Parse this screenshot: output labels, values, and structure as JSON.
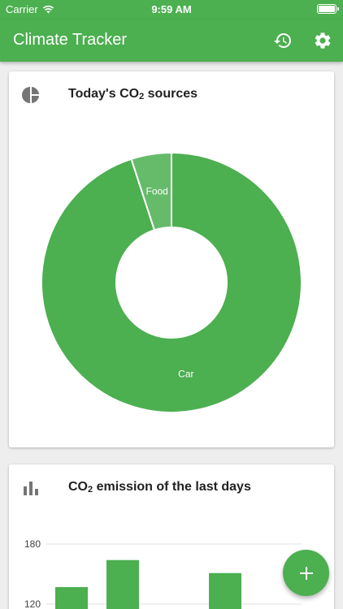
{
  "status_bar": {
    "carrier": "Carrier",
    "time": "9:59 AM"
  },
  "app_bar": {
    "title": "Climate Tracker",
    "history_icon": "history-icon",
    "settings_icon": "gear-icon"
  },
  "sources_card": {
    "title_prefix": "Today's CO",
    "title_sub": "2",
    "title_suffix": " sources",
    "icon": "pie-chart-icon"
  },
  "emissions_card": {
    "title_prefix": "CO",
    "title_sub": "2",
    "title_suffix": " emission of the last days",
    "icon": "bar-chart-icon"
  },
  "fab": {
    "icon": "add-icon"
  },
  "colors": {
    "primary": "#4caf50",
    "food": "#66bb6a",
    "grid": "#e0e0e0"
  },
  "chart_data": [
    {
      "type": "pie",
      "categories": [
        "Car",
        "Food"
      ],
      "values": [
        95,
        5
      ],
      "labels": [
        "Car",
        "Food"
      ],
      "donut": true
    },
    {
      "type": "bar",
      "y_ticks": [
        120,
        180
      ],
      "values": [
        137,
        164,
        null,
        151
      ],
      "grid": true
    }
  ]
}
